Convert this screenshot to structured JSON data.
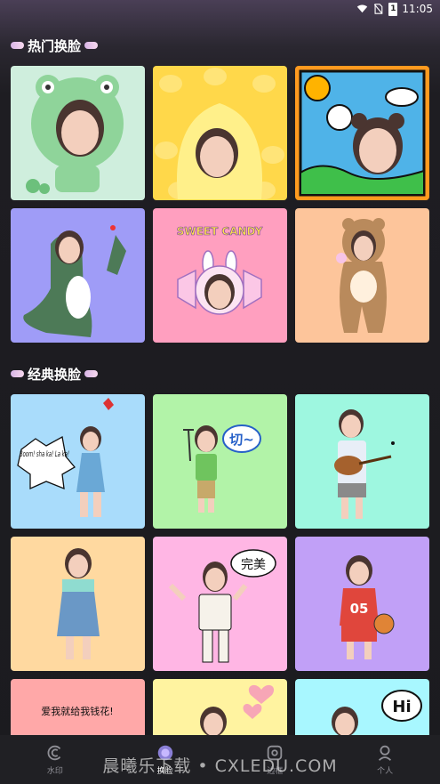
{
  "status_bar": {
    "time": "11:05",
    "battery": "1"
  },
  "sections": [
    {
      "title": "热门换脸"
    },
    {
      "title": "经典换脸"
    }
  ],
  "hot_tiles": [
    {
      "name": "frog-costume",
      "bg": "#cfeedd"
    },
    {
      "name": "duck-costume",
      "bg": "#ffd84a"
    },
    {
      "name": "comic-window",
      "bg": "#ff9a1f"
    },
    {
      "name": "dinosaur-costume",
      "bg": "#9f9cf7",
      "label": ""
    },
    {
      "name": "sweet-candy",
      "bg": "#ff9fbf",
      "label": "SWEET CANDY"
    },
    {
      "name": "bear-costume",
      "bg": "#fdc59b"
    }
  ],
  "classic_tiles": [
    {
      "name": "boom-shakalaka",
      "bg": "#a9dcfb",
      "label": "Boom! sha ka! La ka!"
    },
    {
      "name": "cut-sign",
      "bg": "#b2f3a8",
      "label": "切~"
    },
    {
      "name": "ukulele",
      "bg": "#9ef7e0"
    },
    {
      "name": "overalls",
      "bg": "#ffd9a0"
    },
    {
      "name": "perfect",
      "bg": "#ffb6e4",
      "label": "完美"
    },
    {
      "name": "basketball",
      "bg": "#c1a0f7",
      "label": "05"
    },
    {
      "name": "love-text",
      "bg": "#ffa8a8",
      "label": "爱我就给我钱花!"
    },
    {
      "name": "hearts",
      "bg": "#fff3a0"
    },
    {
      "name": "hi-bubble",
      "bg": "#a8f7ff",
      "label": "Hi"
    }
  ],
  "tabs": [
    {
      "label": "水印",
      "icon": "watermark-icon",
      "active": false
    },
    {
      "label": "换脸",
      "icon": "face-swap-icon",
      "active": true
    },
    {
      "label": "边框",
      "icon": "frame-icon",
      "active": false
    },
    {
      "label": "个人",
      "icon": "person-icon",
      "active": false
    }
  ],
  "watermark_text": "晨曦乐下载 • CXLEDU.COM"
}
